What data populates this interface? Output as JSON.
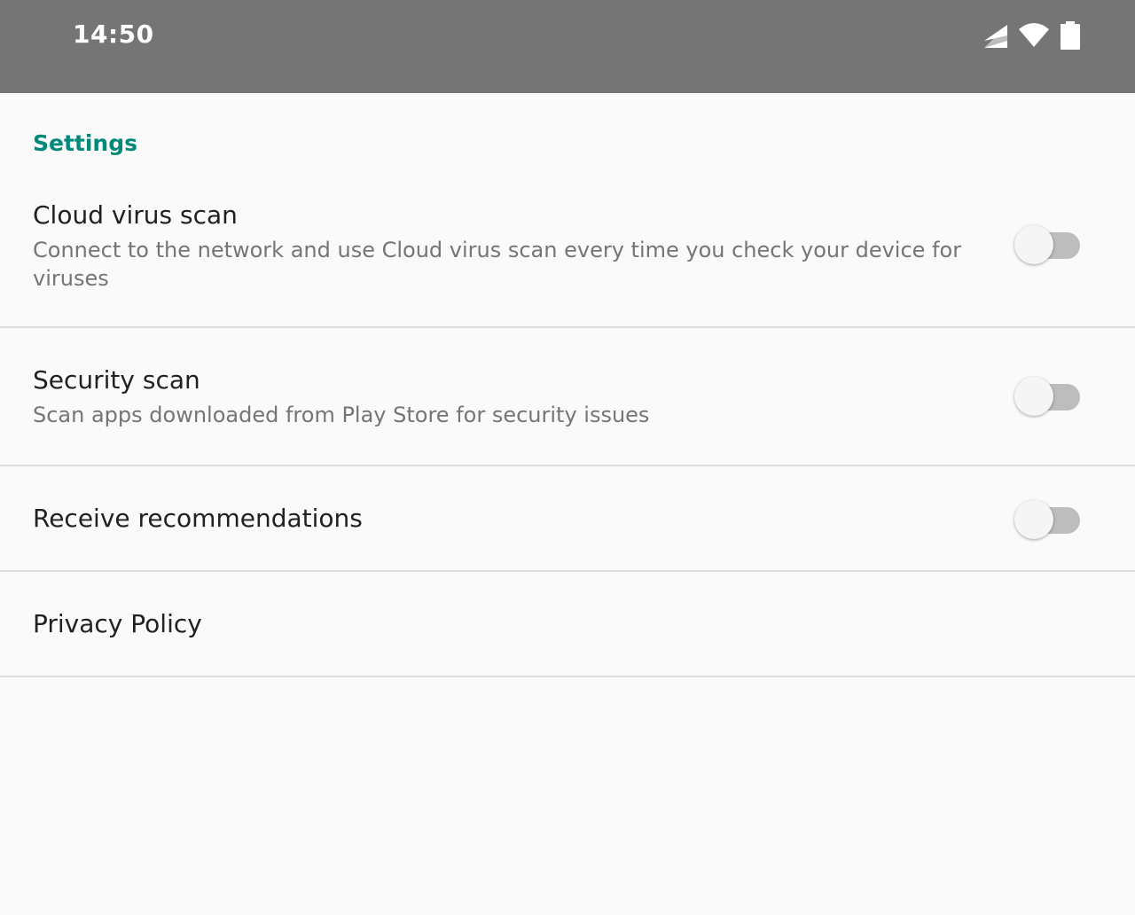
{
  "status_bar": {
    "time": "14:50",
    "icons": [
      "signal-icon",
      "wifi-icon",
      "battery-icon"
    ]
  },
  "settings": {
    "header": "Settings",
    "items": [
      {
        "title": "Cloud virus scan",
        "summary": "Connect to the network and use Cloud virus scan every time you check your device for viruses",
        "toggle": false
      },
      {
        "title": "Security scan",
        "summary": "Scan apps downloaded from Play Store for security issues",
        "toggle": false
      },
      {
        "title": "Receive recommendations",
        "toggle": false
      },
      {
        "title": "Privacy Policy"
      }
    ]
  },
  "colors": {
    "accent": "#00897b",
    "status_bar": "#757575",
    "background": "#fafafa"
  }
}
